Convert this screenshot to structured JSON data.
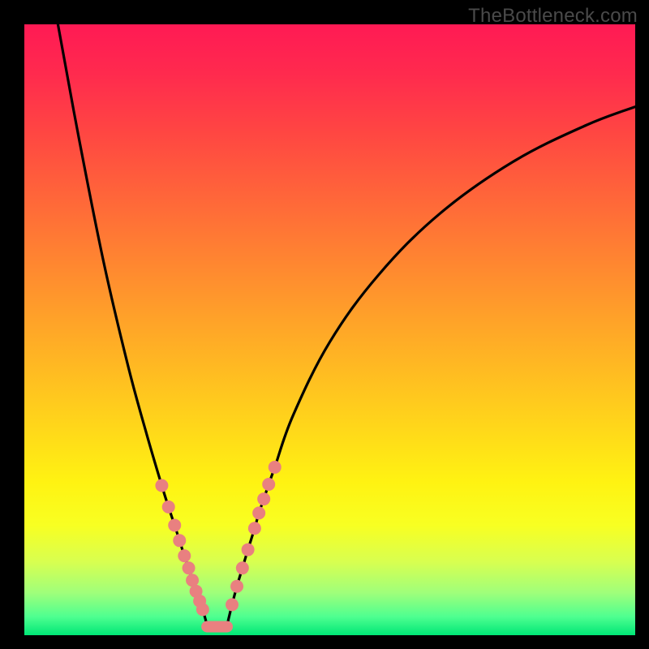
{
  "watermark": "TheBottleneck.com",
  "colors": {
    "bead": "#e98080",
    "curve": "#000000",
    "frame": "#000000"
  },
  "chart_data": {
    "type": "line",
    "title": "",
    "xlabel": "",
    "ylabel": "",
    "xlim": [
      0,
      100
    ],
    "ylim": [
      0,
      100
    ],
    "note": "Schematic bottleneck V-curve; numeric values estimated from pixel positions (x,y as % of plot area, y=0 at top).",
    "series": [
      {
        "name": "left-branch",
        "points": [
          {
            "x": 5.5,
            "y": 0.0
          },
          {
            "x": 9.0,
            "y": 19.0
          },
          {
            "x": 13.0,
            "y": 39.0
          },
          {
            "x": 17.0,
            "y": 56.0
          },
          {
            "x": 20.0,
            "y": 67.0
          },
          {
            "x": 22.5,
            "y": 75.5
          },
          {
            "x": 23.6,
            "y": 79.0
          },
          {
            "x": 24.6,
            "y": 82.0
          },
          {
            "x": 25.4,
            "y": 84.5
          },
          {
            "x": 26.2,
            "y": 87.0
          },
          {
            "x": 26.9,
            "y": 89.0
          },
          {
            "x": 27.5,
            "y": 91.0
          },
          {
            "x": 28.1,
            "y": 92.8
          },
          {
            "x": 28.7,
            "y": 94.4
          },
          {
            "x": 29.2,
            "y": 95.8
          },
          {
            "x": 29.9,
            "y": 98.3
          }
        ]
      },
      {
        "name": "right-branch",
        "points": [
          {
            "x": 33.2,
            "y": 98.3
          },
          {
            "x": 34.0,
            "y": 95.0
          },
          {
            "x": 34.8,
            "y": 92.0
          },
          {
            "x": 35.7,
            "y": 89.0
          },
          {
            "x": 36.6,
            "y": 86.0
          },
          {
            "x": 37.7,
            "y": 82.5
          },
          {
            "x": 38.4,
            "y": 80.0
          },
          {
            "x": 39.2,
            "y": 77.7
          },
          {
            "x": 40.0,
            "y": 75.3
          },
          {
            "x": 41.0,
            "y": 72.5
          },
          {
            "x": 44.0,
            "y": 64.0
          },
          {
            "x": 50.0,
            "y": 52.0
          },
          {
            "x": 58.0,
            "y": 41.0
          },
          {
            "x": 68.0,
            "y": 31.0
          },
          {
            "x": 80.0,
            "y": 22.5
          },
          {
            "x": 92.0,
            "y": 16.5
          },
          {
            "x": 100.0,
            "y": 13.5
          }
        ]
      }
    ],
    "floor_segment": {
      "x0": 29.9,
      "x1": 33.2,
      "y": 98.6
    },
    "left_beads_pct": [
      {
        "x": 22.5,
        "y": 75.5
      },
      {
        "x": 23.6,
        "y": 79.0
      },
      {
        "x": 24.6,
        "y": 82.0
      },
      {
        "x": 25.4,
        "y": 84.5
      },
      {
        "x": 26.2,
        "y": 87.0
      },
      {
        "x": 26.9,
        "y": 89.0
      },
      {
        "x": 27.5,
        "y": 91.0
      },
      {
        "x": 28.1,
        "y": 92.8
      },
      {
        "x": 28.7,
        "y": 94.4
      },
      {
        "x": 29.2,
        "y": 95.8
      }
    ],
    "right_beads_pct": [
      {
        "x": 34.0,
        "y": 95.0
      },
      {
        "x": 34.8,
        "y": 92.0
      },
      {
        "x": 35.7,
        "y": 89.0
      },
      {
        "x": 36.6,
        "y": 86.0
      },
      {
        "x": 37.7,
        "y": 82.5
      },
      {
        "x": 38.4,
        "y": 80.0
      },
      {
        "x": 39.2,
        "y": 77.7
      },
      {
        "x": 40.0,
        "y": 75.3
      },
      {
        "x": 41.0,
        "y": 72.5
      }
    ]
  }
}
